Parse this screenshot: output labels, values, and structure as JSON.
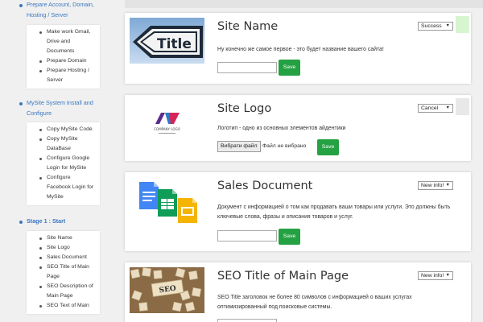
{
  "sidebar": {
    "sections": [
      {
        "heading": "Prepare Account, Domain, Hosting / Server",
        "items": [
          "Make work Gmail, Drive and Documents",
          "Prepare Domain",
          "Prepare Hosting / Server"
        ]
      },
      {
        "heading": "MySite System Install and Configure",
        "items": [
          "Copy MySite Code",
          "Copy MySite DataBase",
          "Configure Google Login for MySite",
          "Configure Facebook Login for MySite"
        ]
      },
      {
        "heading": "Stage 1 : Start",
        "items": [
          "Site Name",
          "Site Logo",
          "Sales Document",
          "SEO Title of Main Page",
          "SEO Description of Main Page",
          "SEO Text of Main"
        ]
      }
    ]
  },
  "cards": [
    {
      "title": "Site Name",
      "description": "Ну конечно же самое первое - это будет название вашего сайта!",
      "status": "Success",
      "save_label": "Save",
      "thumb_text": "Title"
    },
    {
      "title": "Site Logo",
      "description": "Логотип - одно из основных элементов айдентики",
      "status": "Cancel",
      "file_button": "Вибрати файл",
      "file_status": "Файл не вибрано",
      "save_label": "Save",
      "thumb_text": "COMPANY LOGO"
    },
    {
      "title": "Sales Document",
      "description": "Документ с информацией о том как продавать ваши товары или услуги. Это должны быть ключевые слова, фразы и описания товаров и услуг.",
      "status": "New info!",
      "save_label": "Save"
    },
    {
      "title": "SEO Title of Main Page",
      "description": "SEO Title заголовок не более 80 символов с информацией о ваших услугах оптимизированный под поисковые системы.",
      "status": "New info!",
      "thumb_text": "SEO"
    }
  ],
  "colors": {
    "link": "#3a78c2",
    "save_button": "#24a142",
    "status_success": "#d7f5d0",
    "status_default": "#e8e8e8"
  }
}
